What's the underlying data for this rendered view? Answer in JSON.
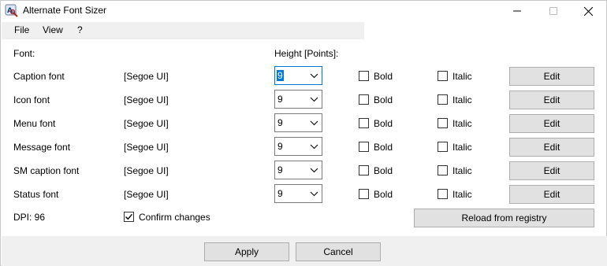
{
  "window": {
    "title": "Alternate Font Sizer"
  },
  "menu": {
    "items": [
      {
        "label": "File"
      },
      {
        "label": "View"
      },
      {
        "label": "?"
      }
    ]
  },
  "headers": {
    "font": "Font:",
    "height": "Height [Points]:"
  },
  "rows": [
    {
      "name": "Caption font",
      "face": "[Segoe UI]",
      "height": "9",
      "bold_label": "Bold",
      "italic_label": "Italic",
      "edit_label": "Edit",
      "bold": false,
      "italic": false
    },
    {
      "name": "Icon font",
      "face": "[Segoe UI]",
      "height": "9",
      "bold_label": "Bold",
      "italic_label": "Italic",
      "edit_label": "Edit",
      "bold": false,
      "italic": false
    },
    {
      "name": "Menu font",
      "face": "[Segoe UI]",
      "height": "9",
      "bold_label": "Bold",
      "italic_label": "Italic",
      "edit_label": "Edit",
      "bold": false,
      "italic": false
    },
    {
      "name": "Message font",
      "face": "[Segoe UI]",
      "height": "9",
      "bold_label": "Bold",
      "italic_label": "Italic",
      "edit_label": "Edit",
      "bold": false,
      "italic": false
    },
    {
      "name": "SM caption font",
      "face": "[Segoe UI]",
      "height": "9",
      "bold_label": "Bold",
      "italic_label": "Italic",
      "edit_label": "Edit",
      "bold": false,
      "italic": false
    },
    {
      "name": "Status font",
      "face": "[Segoe UI]",
      "height": "9",
      "bold_label": "Bold",
      "italic_label": "Italic",
      "edit_label": "Edit",
      "bold": false,
      "italic": false
    }
  ],
  "dpi": "DPI: 96",
  "confirm": {
    "label": "Confirm changes",
    "checked": true
  },
  "buttons": {
    "reload": "Reload from registry",
    "apply": "Apply",
    "cancel": "Cancel"
  },
  "colors": {
    "accent": "#0078d7",
    "menubar_bg": "#f0f0f0",
    "button_bg": "#e1e1e1"
  },
  "icons": {
    "app": "font-sizer-app-icon",
    "minimize": "minimize-icon",
    "maximize": "maximize-icon",
    "close": "close-icon",
    "dropdown": "chevron-down-icon",
    "check": "checkmark-icon"
  }
}
